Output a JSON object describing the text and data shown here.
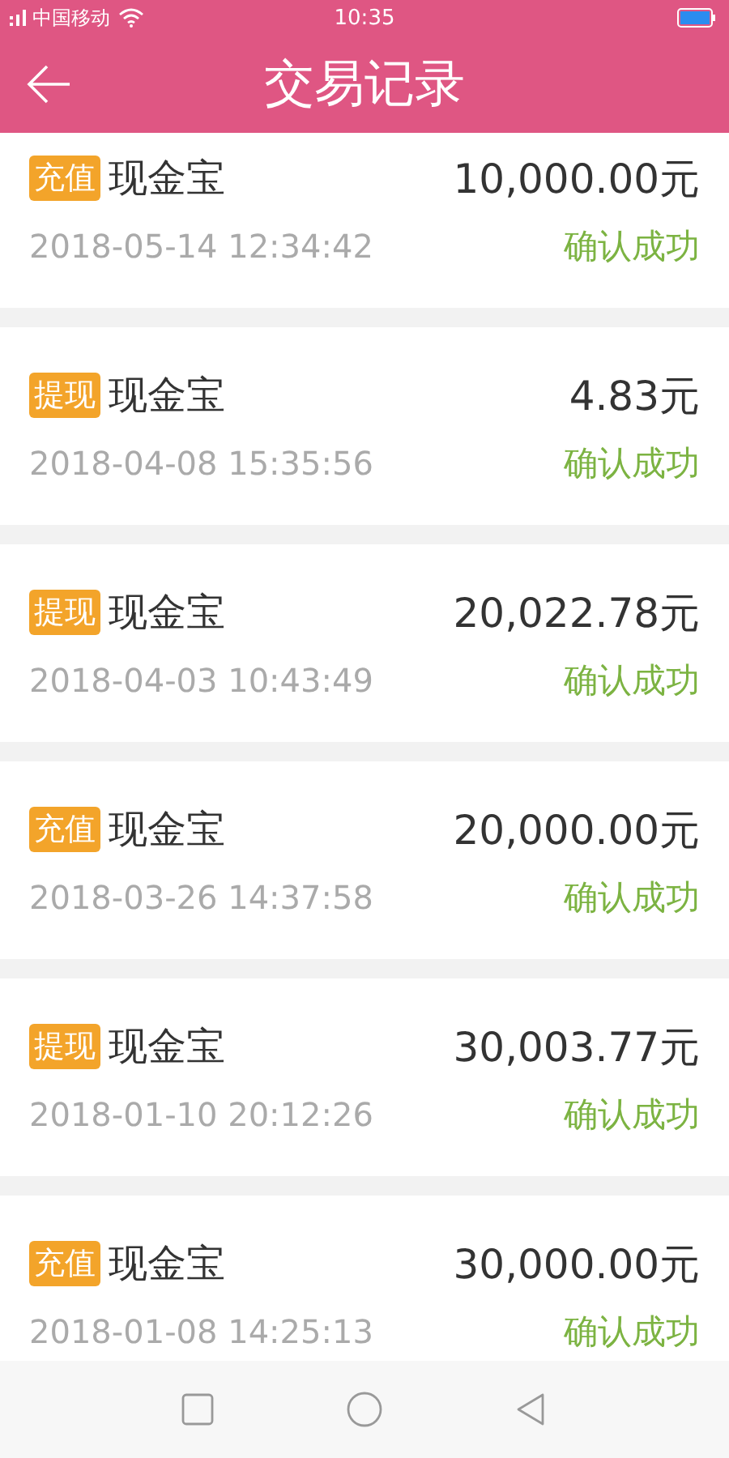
{
  "status_bar": {
    "carrier": "中国移动",
    "time": "10:35"
  },
  "header": {
    "title": "交易记录"
  },
  "transactions": [
    {
      "tag": "充值",
      "product": "现金宝",
      "amount": "10,000.00元",
      "time": "2018-05-14 12:34:42",
      "status": "确认成功"
    },
    {
      "tag": "提现",
      "product": "现金宝",
      "amount": "4.83元",
      "time": "2018-04-08 15:35:56",
      "status": "确认成功"
    },
    {
      "tag": "提现",
      "product": "现金宝",
      "amount": "20,022.78元",
      "time": "2018-04-03 10:43:49",
      "status": "确认成功"
    },
    {
      "tag": "充值",
      "product": "现金宝",
      "amount": "20,000.00元",
      "time": "2018-03-26 14:37:58",
      "status": "确认成功"
    },
    {
      "tag": "提现",
      "product": "现金宝",
      "amount": "30,003.77元",
      "time": "2018-01-10 20:12:26",
      "status": "确认成功"
    },
    {
      "tag": "充值",
      "product": "现金宝",
      "amount": "30,000.00元",
      "time": "2018-01-08 14:25:13",
      "status": "确认成功"
    }
  ]
}
